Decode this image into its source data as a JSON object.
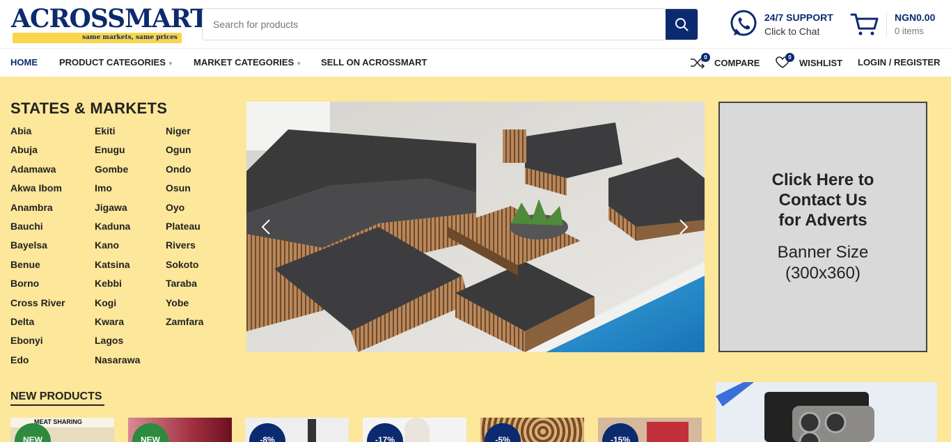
{
  "brand": {
    "name": "ACROSSMART",
    "tagline": "same markets, same prices",
    "primary_color": "#0b2a6f",
    "accent_color": "#f8d54a"
  },
  "search": {
    "placeholder": "Search for products",
    "icon": "search-icon"
  },
  "support": {
    "title": "24/7 SUPPORT",
    "subtitle": "Click to Chat",
    "icon": "whatsapp-icon"
  },
  "cart": {
    "amount": "NGN0.00",
    "items": "0 items",
    "icon": "cart-icon"
  },
  "nav": {
    "home": "HOME",
    "product_categories": "PRODUCT CATEGORIES",
    "market_categories": "MARKET CATEGORIES",
    "sell": "SELL ON ACROSSMART",
    "compare": "COMPARE",
    "compare_count": "0",
    "wishlist": "WISHLIST",
    "wishlist_count": "0",
    "login": "LOGIN / REGISTER"
  },
  "states": {
    "title": "STATES & MARKETS",
    "col1": [
      "Abia",
      "Abuja",
      "Adamawa",
      "Akwa Ibom",
      "Anambra",
      "Bauchi",
      "Bayelsa",
      "Benue",
      "Borno",
      "Cross River",
      "Delta",
      "Ebonyi",
      "Edo"
    ],
    "col2": [
      "Ekiti",
      "Enugu",
      "Gombe",
      "Imo",
      "Jigawa",
      "Kaduna",
      "Kano",
      "Katsina",
      "Kebbi",
      "Kogi",
      "Kwara",
      "Lagos",
      "Nasarawa"
    ],
    "col3": [
      "Niger",
      "Ogun",
      "Ondo",
      "Osun",
      "Oyo",
      "Plateau",
      "Rivers",
      "Sokoto",
      "Taraba",
      "Yobe",
      "Zamfara"
    ]
  },
  "ad_banner": {
    "heading": "Click Here to\nContact Us\nfor Adverts",
    "size": "Banner Size\n(300x360)"
  },
  "new_products": {
    "title": "NEW PRODUCTS",
    "items": [
      {
        "badge": "NEW",
        "image_caption": "MEAT SHARING"
      },
      {
        "badge": "NEW"
      },
      {
        "badge": "-8%"
      },
      {
        "badge": "-17%"
      },
      {
        "badge": "-5%"
      },
      {
        "badge": "-15%"
      }
    ]
  }
}
